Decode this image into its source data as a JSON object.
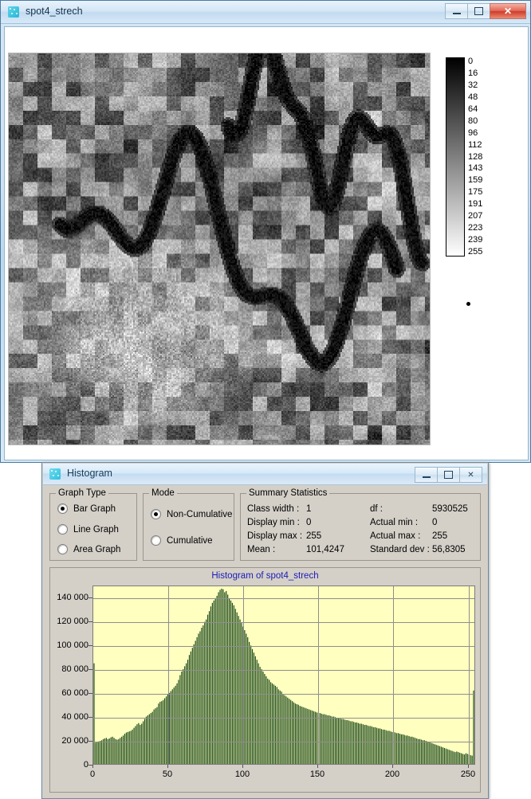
{
  "main_window": {
    "title": "spot4_strech",
    "icon": "app-raster-icon",
    "buttons": {
      "minimize": "–",
      "maximize": "□",
      "close": "✕"
    }
  },
  "colorbar": {
    "name": "grayscale-colorbar",
    "orientation": "vertical",
    "top_color": "#000000",
    "bottom_color": "#ffffff",
    "ticks": [
      0,
      16,
      32,
      48,
      64,
      80,
      96,
      112,
      128,
      143,
      159,
      175,
      191,
      207,
      223,
      239,
      255
    ]
  },
  "histogram_window": {
    "title": "Histogram",
    "icon": "app-raster-icon",
    "buttons": {
      "minimize": "–",
      "maximize": "□",
      "close": "✕"
    },
    "graph_type": {
      "legend": "Graph Type",
      "options": [
        {
          "label": "Bar Graph",
          "checked": true
        },
        {
          "label": "Line Graph",
          "checked": false
        },
        {
          "label": "Area Graph",
          "checked": false
        }
      ]
    },
    "mode": {
      "legend": "Mode",
      "options": [
        {
          "label": "Non-Cumulative",
          "checked": true
        },
        {
          "label": "Cumulative",
          "checked": false
        }
      ]
    },
    "summary": {
      "legend": "Summary Statistics",
      "rows": [
        {
          "label_l": "Class width :",
          "value_l": "1",
          "label_r": "df :",
          "value_r": "5930525"
        },
        {
          "label_l": "Display min :",
          "value_l": "0",
          "label_r": "Actual min :",
          "value_r": "0"
        },
        {
          "label_l": "Display max :",
          "value_l": "255",
          "label_r": "Actual max :",
          "value_r": "255"
        },
        {
          "label_l": "Mean :",
          "value_l": "101,4247",
          "label_r": "Standard dev :",
          "value_r": "56,8305"
        }
      ]
    }
  },
  "chart_data": {
    "type": "bar",
    "title": "Histogram of spot4_strech",
    "xlabel": "",
    "ylabel": "",
    "xlim": [
      0,
      255
    ],
    "ylim": [
      0,
      150000
    ],
    "grid": true,
    "legend": null,
    "bar_color": "#1d4a1d",
    "plot_bg": "#ffffbf",
    "xticks": [
      0,
      50,
      100,
      150,
      200,
      250
    ],
    "yticks": [
      0,
      20000,
      40000,
      60000,
      80000,
      100000,
      120000,
      140000
    ],
    "ytick_labels": [
      "0",
      "20 000",
      "40 000",
      "60 000",
      "80 000",
      "100 000",
      "120 000",
      "140 000"
    ],
    "x": [
      0,
      1,
      2,
      3,
      4,
      5,
      6,
      7,
      8,
      9,
      10,
      11,
      12,
      13,
      14,
      15,
      16,
      17,
      18,
      19,
      20,
      21,
      22,
      23,
      24,
      25,
      26,
      27,
      28,
      29,
      30,
      31,
      32,
      33,
      34,
      35,
      36,
      37,
      38,
      39,
      40,
      41,
      42,
      43,
      44,
      45,
      46,
      47,
      48,
      49,
      50,
      51,
      52,
      53,
      54,
      55,
      56,
      57,
      58,
      59,
      60,
      61,
      62,
      63,
      64,
      65,
      66,
      67,
      68,
      69,
      70,
      71,
      72,
      73,
      74,
      75,
      76,
      77,
      78,
      79,
      80,
      81,
      82,
      83,
      84,
      85,
      86,
      87,
      88,
      89,
      90,
      91,
      92,
      93,
      94,
      95,
      96,
      97,
      98,
      99,
      100,
      101,
      102,
      103,
      104,
      105,
      106,
      107,
      108,
      109,
      110,
      111,
      112,
      113,
      114,
      115,
      116,
      117,
      118,
      119,
      120,
      121,
      122,
      123,
      124,
      125,
      126,
      127,
      128,
      129,
      130,
      131,
      132,
      133,
      134,
      135,
      136,
      137,
      138,
      139,
      140,
      141,
      142,
      143,
      144,
      145,
      146,
      147,
      148,
      149,
      150,
      151,
      152,
      153,
      154,
      155,
      156,
      157,
      158,
      159,
      160,
      161,
      162,
      163,
      164,
      165,
      166,
      167,
      168,
      169,
      170,
      171,
      172,
      173,
      174,
      175,
      176,
      177,
      178,
      179,
      180,
      181,
      182,
      183,
      184,
      185,
      186,
      187,
      188,
      189,
      190,
      191,
      192,
      193,
      194,
      195,
      196,
      197,
      198,
      199,
      200,
      201,
      202,
      203,
      204,
      205,
      206,
      207,
      208,
      209,
      210,
      211,
      212,
      213,
      214,
      215,
      216,
      217,
      218,
      219,
      220,
      221,
      222,
      223,
      224,
      225,
      226,
      227,
      228,
      229,
      230,
      231,
      232,
      233,
      234,
      235,
      236,
      237,
      238,
      239,
      240,
      241,
      242,
      243,
      244,
      245,
      246,
      247,
      248,
      249,
      250,
      251,
      252,
      253,
      254,
      255
    ],
    "values": [
      85000,
      18000,
      18500,
      19000,
      19500,
      20000,
      21000,
      21500,
      22000,
      21000,
      21500,
      22500,
      23000,
      22000,
      21000,
      20500,
      21000,
      22000,
      23000,
      24000,
      25500,
      26500,
      27000,
      27500,
      28000,
      29000,
      30500,
      32000,
      33500,
      34500,
      33000,
      34000,
      36000,
      38000,
      40000,
      41000,
      42000,
      43000,
      44000,
      46000,
      47000,
      48000,
      51000,
      52500,
      53000,
      54000,
      55500,
      57000,
      58500,
      60000,
      61500,
      63000,
      64500,
      66000,
      68000,
      71000,
      75000,
      78000,
      80000,
      82500,
      85000,
      88000,
      92000,
      95000,
      98000,
      101000,
      104000,
      107000,
      110000,
      112000,
      115000,
      117000,
      120000,
      122000,
      126000,
      129000,
      133000,
      136000,
      138000,
      140000,
      142000,
      145000,
      147000,
      148000,
      147500,
      145000,
      146000,
      143000,
      140000,
      138000,
      136000,
      134000,
      131000,
      128000,
      125000,
      122000,
      119000,
      116000,
      113000,
      110000,
      107000,
      103000,
      100000,
      97000,
      94000,
      91000,
      88000,
      85000,
      82000,
      80000,
      78000,
      76000,
      74000,
      72000,
      71000,
      69000,
      68000,
      67000,
      66000,
      65000,
      63000,
      62000,
      61000,
      59000,
      58000,
      57000,
      56000,
      55000,
      54000,
      53000,
      52000,
      51000,
      50500,
      50000,
      49000,
      48500,
      48000,
      47500,
      47000,
      46500,
      46000,
      45500,
      45000,
      44500,
      44000,
      43500,
      43000,
      43000,
      42500,
      42000,
      42000,
      41500,
      41000,
      41000,
      40500,
      40000,
      40000,
      39500,
      39000,
      39000,
      38500,
      38000,
      38000,
      37500,
      37000,
      37000,
      36500,
      36000,
      36000,
      35500,
      35000,
      35000,
      34500,
      34000,
      34000,
      33500,
      33000,
      33000,
      32500,
      32000,
      32000,
      31500,
      31000,
      31000,
      30500,
      30000,
      30000,
      29500,
      29000,
      29000,
      28500,
      28000,
      28000,
      27500,
      27000,
      27000,
      26500,
      26000,
      26000,
      25500,
      25000,
      25000,
      24500,
      24000,
      24000,
      23500,
      23000,
      23000,
      22500,
      22000,
      21500,
      21000,
      21000,
      20500,
      20000,
      20000,
      19500,
      19000,
      18500,
      18000,
      17500,
      17000,
      16500,
      16000,
      15500,
      15000,
      14500,
      14000,
      13500,
      13000,
      12500,
      12000,
      11500,
      11000,
      10500,
      10000,
      10500,
      10000,
      9500,
      9000,
      8500,
      8000,
      9000,
      8500,
      8000,
      7500,
      7000,
      62000
    ]
  }
}
